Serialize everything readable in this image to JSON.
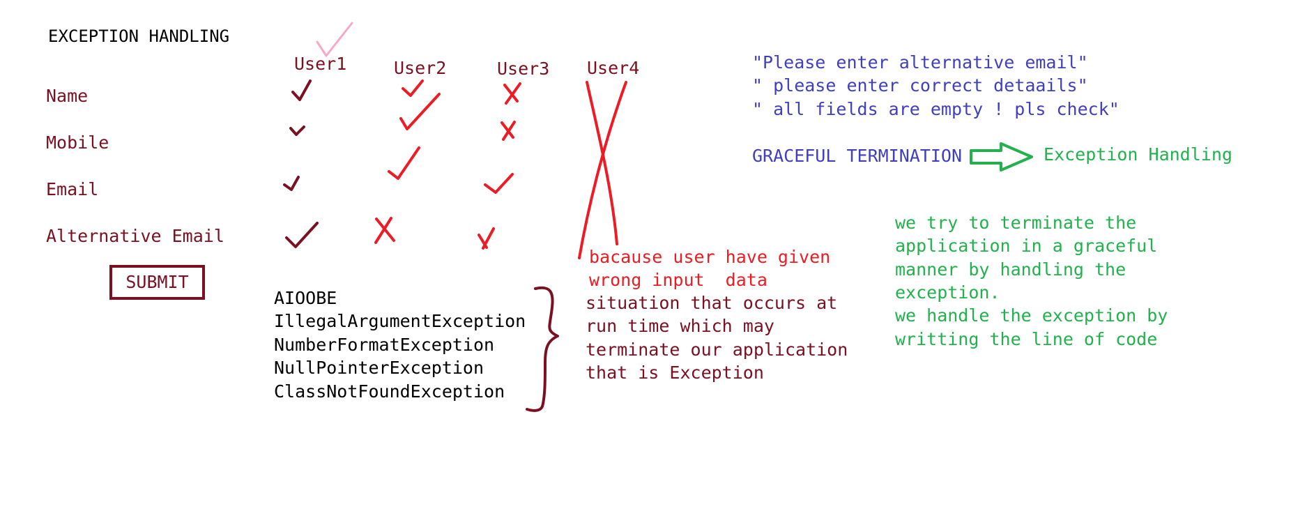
{
  "title": "EXCEPTION HANDLING",
  "users": [
    "User1",
    "User2",
    "User3",
    "User4"
  ],
  "fields": [
    "Name",
    "Mobile",
    "Email",
    "Alternative Email"
  ],
  "submit_label": "SUBMIT",
  "exceptions": [
    "AIOOBE",
    "IllegalArgumentException",
    "NumberFormatException",
    "NullPointerException",
    "ClassNotFoundException"
  ],
  "reason_lines": [
    "bacause user have given",
    "wrong input  data"
  ],
  "definition_lines": [
    "situation that occurs at",
    "run time which may",
    "terminate our application",
    "that is Exception"
  ],
  "messages": [
    "\"Please enter alternative email\"",
    "\" please enter correct detaails\"",
    "\" all fields are empty ! pls check\""
  ],
  "graceful_termination": "GRACEFUL TERMINATION",
  "exception_handling": "Exception Handling",
  "explanation_lines": [
    "we try to terminate the",
    "application in a graceful",
    "manner by handling the",
    "exception.",
    "we handle the exception by",
    "writting the line of code"
  ],
  "colors": {
    "maroon": "#7b1020",
    "red": "#ed1c24",
    "pink": "#f7a8c8",
    "blue": "#3f3fbf",
    "green": "#22b14c"
  }
}
